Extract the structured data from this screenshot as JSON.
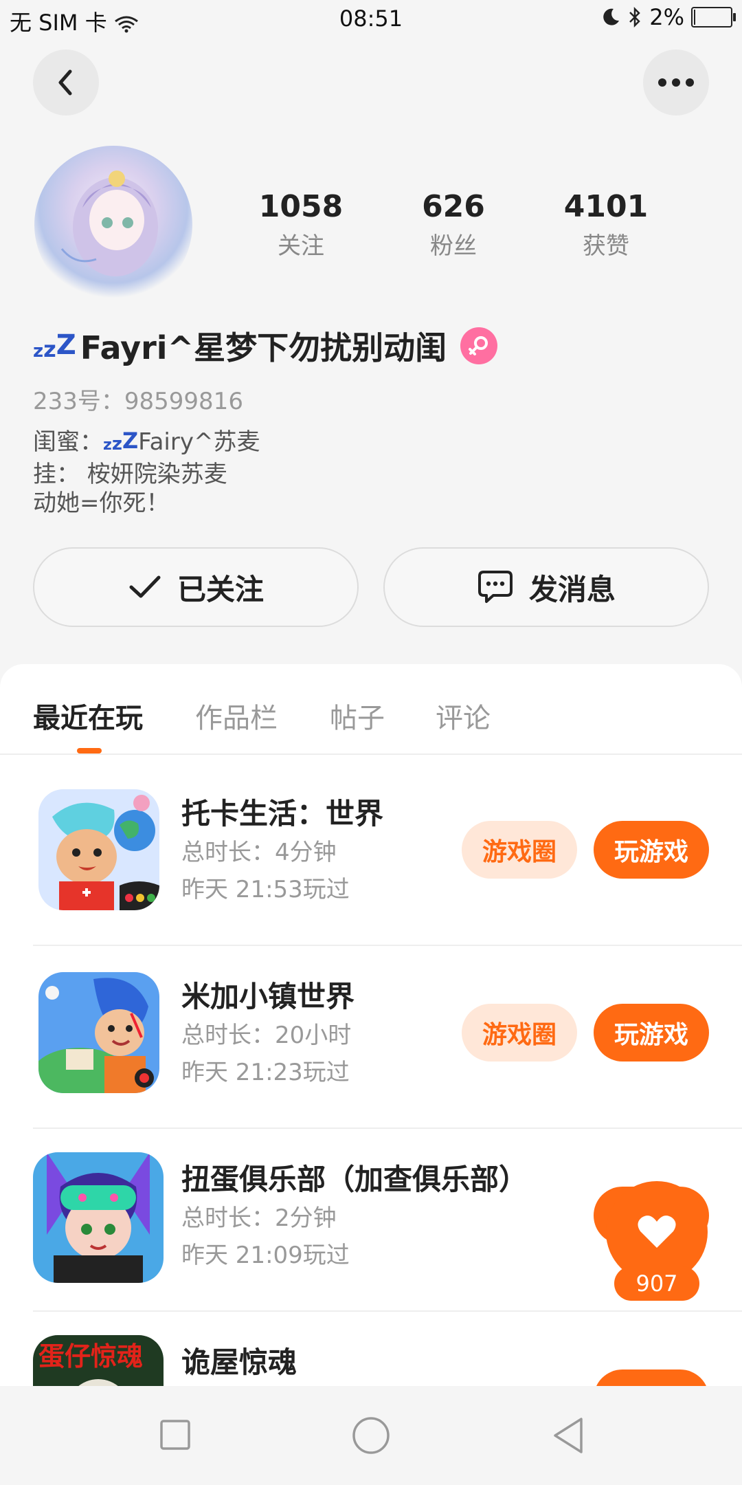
{
  "status_bar": {
    "carrier": "无 SIM 卡",
    "time": "08:51",
    "battery": "2%",
    "battery_level": 0.02
  },
  "profile": {
    "stats": [
      {
        "value": "1058",
        "label": "关注"
      },
      {
        "value": "626",
        "label": "粉丝"
      },
      {
        "value": "4101",
        "label": "获赞"
      }
    ],
    "nickname_prefix": "zzZ",
    "nickname": "Fayri^星梦下勿扰别动闺",
    "uid": "233号：98599816",
    "bio": {
      "line1_a": "闺蜜：",
      "line1_prefix": "zzZ",
      "line1_b": "Fairy^苏麦",
      "line2": "挂： 桉妍院染苏麦",
      "line3": "动她=你死！"
    },
    "follow_label": "已关注",
    "message_label": "发消息"
  },
  "tabs": [
    {
      "label": "最近在玩",
      "active": true
    },
    {
      "label": "作品栏",
      "active": false
    },
    {
      "label": "帖子",
      "active": false
    },
    {
      "label": "评论",
      "active": false
    }
  ],
  "games": [
    {
      "name": "托卡生活：世界",
      "duration": "总时长：4分钟",
      "last_played": "昨天 21:53玩过",
      "circle_label": "游戏圈",
      "play_label": "玩游戏"
    },
    {
      "name": "米加小镇世界",
      "duration": "总时长：20小时",
      "last_played": "昨天 21:23玩过",
      "circle_label": "游戏圈",
      "play_label": "玩游戏"
    },
    {
      "name": "扭蛋俱乐部（加查俱乐部）",
      "duration": "总时长：2分钟",
      "last_played": "昨天 21:09玩过"
    },
    {
      "name": "诡屋惊魂",
      "icon_text": "蛋仔惊魂"
    }
  ],
  "like_fab": {
    "count": "907"
  },
  "colors": {
    "accent": "#ff6a13",
    "accent_light": "#ffe7d8",
    "gender": "#ff6fa1",
    "zzz": "#2c55c7"
  }
}
